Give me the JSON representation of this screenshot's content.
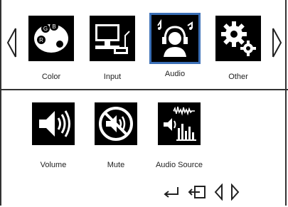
{
  "top_row": {
    "tiles": [
      {
        "label": "Color",
        "icon": "palette-icon"
      },
      {
        "label": "Input",
        "icon": "input-computer-icon"
      },
      {
        "label": "Audio",
        "icon": "headphones-person-icon",
        "selected": true
      },
      {
        "label": "Other",
        "icon": "gears-icon"
      }
    ]
  },
  "audio_menu": {
    "tiles": [
      {
        "label": "Volume",
        "icon": "speaker-icon"
      },
      {
        "label": "Mute",
        "icon": "mute-icon"
      },
      {
        "label": "Audio Source",
        "icon": "audio-source-icon"
      }
    ]
  },
  "nav_hints": [
    "enter-icon",
    "exit-icon",
    "left-arrow-icon",
    "right-arrow-icon"
  ],
  "colors": {
    "selection": "#3b6fb6"
  }
}
